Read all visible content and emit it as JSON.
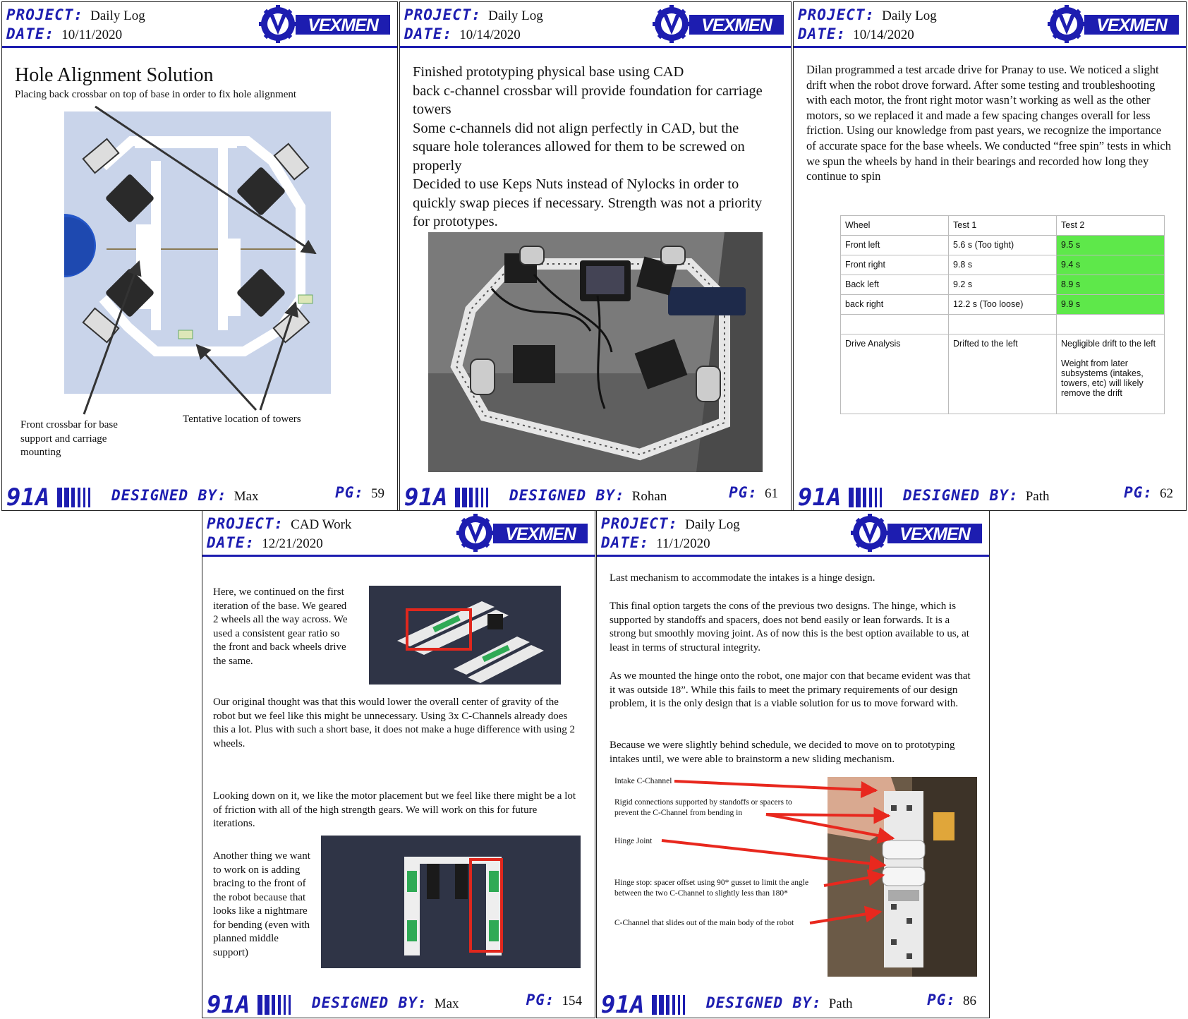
{
  "labels": {
    "project": "PROJECT:",
    "date": "DATE:",
    "designed_by": "DESIGNED BY:",
    "pg": "PG:"
  },
  "brand": {
    "logo_text": "VEXMEN",
    "team_number": "91A",
    "accent_color": "#1d1db0"
  },
  "pages": {
    "p1": {
      "project": "Daily Log",
      "date": "10/11/2020",
      "designer": "Max",
      "page": "59",
      "title": "Hole Alignment Solution",
      "subtitle": "Placing back crossbar on top of base in order to fix hole alignment",
      "callout_front": "Front crossbar for base support and carriage mounting",
      "callout_towers": "Tentative location of towers"
    },
    "p2": {
      "project": "Daily Log",
      "date": "10/14/2020",
      "designer": "Rohan",
      "page": "61",
      "lines": [
        "Finished prototyping physical base using CAD",
        "back c-channel crossbar will provide foundation for carriage towers",
        "Some c-channels did not align perfectly in CAD, but the square hole tolerances allowed for them to be screwed on properly",
        "Decided to use Keps Nuts instead of Nylocks in order to quickly swap pieces if necessary. Strength was not a priority for prototypes."
      ]
    },
    "p3": {
      "project": "Daily Log",
      "date": "10/14/2020",
      "designer": "Path",
      "page": "62",
      "paragraph": "Dilan programmed a test arcade drive for Pranay to use. We noticed a slight drift when the robot drove forward. After some testing and troubleshooting with each motor, the front right motor wasn’t working as well as the other motors, so we replaced it and made a few spacing changes overall for less friction. Using our knowledge from past years, we recognize the importance of accurate space for the base wheels. We conducted “free spin” tests in which we spun the wheels by hand in their bearings and recorded how long they continue to spin",
      "table": {
        "headers": [
          "Wheel",
          "Test 1",
          "Test 2"
        ],
        "rows": [
          [
            "Front left",
            "5.6 s (Too tight)",
            "9.5 s"
          ],
          [
            "Front right",
            "9.8  s",
            "9.4 s"
          ],
          [
            "Back left",
            "9.2 s",
            "8.9 s"
          ],
          [
            "back right",
            "12.2 s (Too loose)",
            "9.9 s"
          ]
        ],
        "analysis": {
          "label": "Drive Analysis",
          "test1": "Drifted to the left",
          "test2a": "Negligible drift to the left",
          "test2b": "Weight from later subsystems (intakes, towers, etc) will likely remove the drift"
        },
        "highlight_color": "#5ee84a"
      }
    },
    "p4": {
      "project": "CAD Work",
      "date": "12/21/2020",
      "designer": "Max",
      "page": "154",
      "para1": "Here, we continued on the first iteration of the base. We geared 2 wheels all the way across. We used a consistent gear ratio so the front and back wheels drive the same.",
      "para2": "Our original thought was that this would lower the overall center of gravity of the robot but we feel like this might be unnecessary. Using 3x C-Channels already does this a lot. Plus with such a short base, it does not make a huge difference with using 2 wheels.",
      "para3": "Looking down on it, we like the motor placement but we feel like there might be a lot of friction with all of the high strength gears. We will work on this for future iterations.",
      "para4": "Another thing we want to work on is adding bracing to the front of the robot because that looks like a nightmare for bending (even with planned middle support)"
    },
    "p5": {
      "project": "Daily Log",
      "date": "11/1/2020",
      "designer": "Path",
      "page": "86",
      "para1": "Last mechanism to accommodate the intakes is a hinge design.",
      "para2": "This final option targets the cons of the previous two designs. The hinge, which is supported by standoffs and spacers, does not bend easily or lean forwards. It is a strong but smoothly moving joint. As of now this is the best option available to us, at least in terms of structural integrity.",
      "para3": "As we mounted the hinge onto the robot, one major con that became evident was that it was outside 18”. While this fails to meet the primary requirements of our design problem, it is the only design that is a viable solution for us to move forward with.",
      "para4": "Because we were slightly behind schedule, we decided to move on to prototyping intakes until, we were able to brainstorm a new sliding mechanism.",
      "labels": [
        "Intake C-Channel",
        "Rigid connections supported by standoffs or spacers to prevent the C-Channel from bending in",
        "Hinge Joint",
        "Hinge stop: spacer offset using 90* gusset to limit the angle between the two C-Channel to slightly less than 180*",
        "C-Channel that slides out of the main body of the robot"
      ]
    }
  }
}
